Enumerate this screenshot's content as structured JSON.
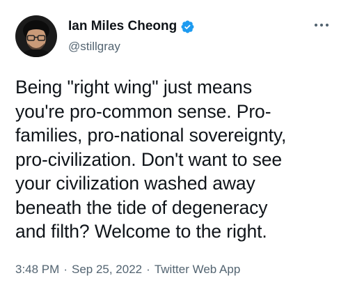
{
  "author": {
    "display_name": "Ian Miles Cheong",
    "handle": "@stillgray",
    "verified": true,
    "avatar_icon": "avatar-photo"
  },
  "tweet": {
    "text": "Being \"right wing\" just means\nyou're pro-common sense. Pro-\nfamilies, pro-national sovereignty,\npro-civilization. Don't want to see\nyour civilization washed away\nbeneath the tide of degeneracy\nand filth? Welcome to the right.",
    "time": "3:48 PM",
    "date": "Sep 25, 2022",
    "source": "Twitter Web App",
    "separator": "·"
  },
  "icons": {
    "more": "more-options-icon",
    "verified": "verified-badge-icon"
  },
  "colors": {
    "text": "#0f1419",
    "secondary": "#536471",
    "verified_blue": "#1d9bf0"
  }
}
